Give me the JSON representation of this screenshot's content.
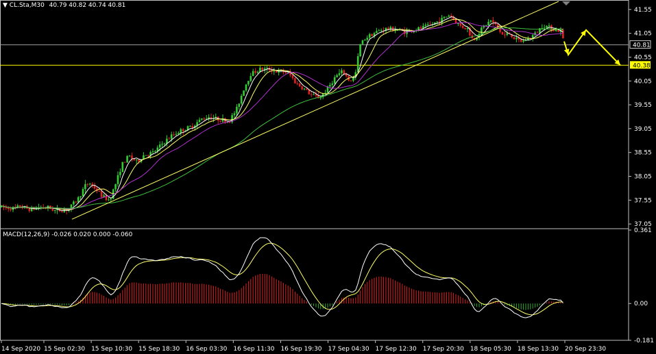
{
  "header": {
    "symbol_label": "CL.Sta,M30",
    "ohlc_label": "40.79 40.82 40.74 40.81",
    "macd_label": "MACD(12,26,9) -0.026 0.020 0.000 -0.060"
  },
  "colors": {
    "background": "#000000",
    "bull": "#33cc33",
    "bear": "#e02020",
    "ma_fast": "#ffffff",
    "ma_medium": "#ffff66",
    "ma_slow": "#b030d0",
    "ma_long": "#40c040",
    "trendline": "#ffff66",
    "hline": "#ffff00",
    "arrow": "#ffff00",
    "macd_signal": "#ffff66",
    "macd_main": "#ffffff",
    "hist_pos": "#e02020",
    "hist_neg": "#33aa33"
  },
  "chart_data": [
    {
      "type": "candlestick",
      "ylim": [
        36.98,
        41.72
      ],
      "yticks": [
        "41.55",
        "41.05",
        "40.55",
        "40.05",
        "39.55",
        "39.05",
        "38.55",
        "38.05",
        "37.55",
        "37.05"
      ],
      "xticks": [
        "14 Sep 2020",
        "15 Sep 02:30",
        "15 Sep 10:30",
        "15 Sep 18:30",
        "16 Sep 03:30",
        "16 Sep 11:30",
        "16 Sep 19:30",
        "17 Sep 04:30",
        "17 Sep 12:30",
        "17 Sep 20:30",
        "18 Sep 05:30",
        "18 Sep 13:30",
        "20 Sep 23:30"
      ],
      "current_price": "40.81",
      "level_price": "40.38",
      "level_value": 40.38,
      "current_value": 40.81,
      "price_path": [
        [
          0,
          37.4
        ],
        [
          20,
          37.38
        ],
        [
          30,
          37.42
        ],
        [
          45,
          37.35
        ],
        [
          55,
          37.4
        ],
        [
          70,
          37.4
        ],
        [
          80,
          37.33
        ],
        [
          100,
          37.36
        ],
        [
          115,
          37.6
        ],
        [
          124,
          37.85
        ],
        [
          130,
          37.92
        ],
        [
          142,
          37.75
        ],
        [
          150,
          37.62
        ],
        [
          160,
          37.55
        ],
        [
          170,
          37.95
        ],
        [
          178,
          38.3
        ],
        [
          188,
          38.48
        ],
        [
          200,
          38.35
        ],
        [
          210,
          38.5
        ],
        [
          224,
          38.55
        ],
        [
          238,
          38.75
        ],
        [
          250,
          38.9
        ],
        [
          262,
          39.0
        ],
        [
          280,
          39.1
        ],
        [
          294,
          39.25
        ],
        [
          305,
          39.3
        ],
        [
          318,
          39.25
        ],
        [
          334,
          39.2
        ],
        [
          345,
          39.45
        ],
        [
          356,
          39.9
        ],
        [
          366,
          40.2
        ],
        [
          380,
          40.3
        ],
        [
          392,
          40.3
        ],
        [
          402,
          40.25
        ],
        [
          412,
          40.25
        ],
        [
          422,
          40.2
        ],
        [
          432,
          40.0
        ],
        [
          442,
          39.9
        ],
        [
          455,
          39.75
        ],
        [
          466,
          39.7
        ],
        [
          476,
          39.85
        ],
        [
          490,
          40.15
        ],
        [
          500,
          40.25
        ],
        [
          510,
          40.05
        ],
        [
          518,
          40.15
        ],
        [
          525,
          40.8
        ],
        [
          533,
          40.95
        ],
        [
          545,
          41.05
        ],
        [
          556,
          41.12
        ],
        [
          565,
          41.15
        ],
        [
          580,
          41.12
        ],
        [
          590,
          41.08
        ],
        [
          602,
          41.12
        ],
        [
          612,
          41.15
        ],
        [
          624,
          41.2
        ],
        [
          636,
          41.28
        ],
        [
          646,
          41.35
        ],
        [
          656,
          41.45
        ],
        [
          664,
          41.3
        ],
        [
          672,
          41.2
        ],
        [
          682,
          41.15
        ],
        [
          690,
          40.9
        ],
        [
          698,
          41.05
        ],
        [
          706,
          41.2
        ],
        [
          716,
          41.32
        ],
        [
          724,
          41.2
        ],
        [
          734,
          41.0
        ],
        [
          744,
          41.05
        ],
        [
          752,
          40.92
        ],
        [
          762,
          40.88
        ],
        [
          772,
          40.95
        ],
        [
          782,
          41.05
        ],
        [
          792,
          41.22
        ],
        [
          800,
          41.18
        ],
        [
          810,
          41.12
        ],
        [
          818,
          41.1
        ],
        [
          824,
          40.81
        ]
      ],
      "moving_average_periods": [
        5,
        10,
        20,
        60
      ],
      "trendline": {
        "from": [
          105,
          37.15
        ],
        "to": [
          815,
          41.72
        ]
      },
      "arrow_path": [
        [
          823,
          40.88
        ],
        [
          829,
          40.6
        ],
        [
          855,
          41.12
        ],
        [
          905,
          40.38
        ]
      ]
    },
    {
      "type": "macd",
      "params": [
        12,
        26,
        9
      ],
      "ylim": [
        -0.181,
        0.361
      ],
      "yticks": [
        "0.361",
        "0.00",
        "-0.181"
      ],
      "values": {
        "main": -0.026,
        "signal": 0.02,
        "histogram": 0.0,
        "extra": -0.06
      }
    }
  ]
}
